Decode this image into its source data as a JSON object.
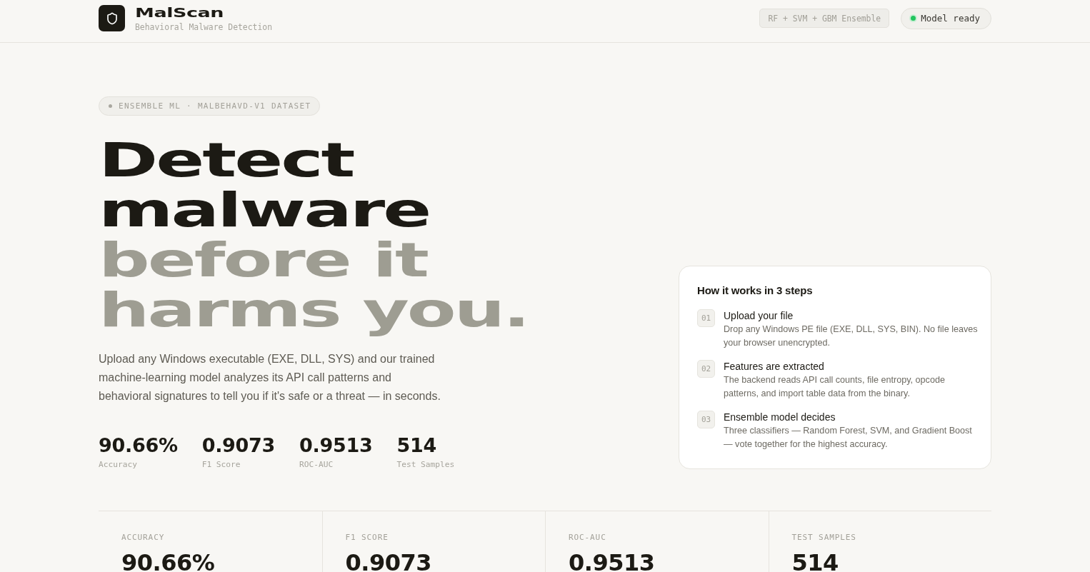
{
  "header": {
    "app_title": "MalScan",
    "app_subtitle": "Behavioral Malware Detection",
    "model_tag": "RF + SVM + GBM Ensemble",
    "status": {
      "label": "Model ready",
      "ready": true
    }
  },
  "hero": {
    "tag": "ENSEMBLE ML · MALBEHAVD-V1 DATASET",
    "headline": [
      {
        "text": "Detect",
        "muted": false
      },
      {
        "text": "malware",
        "muted": false
      },
      {
        "text": "before it",
        "muted": true
      },
      {
        "text": "harms you.",
        "muted": true
      }
    ],
    "description": "Upload any Windows executable (EXE, DLL, SYS) and our trained machine-learning model analyzes its API call patterns and behavioral signatures to tell you if it's safe or a threat — in seconds.",
    "stats": [
      {
        "value": "90.66%",
        "label": "Accuracy"
      },
      {
        "value": "0.9073",
        "label": "F1 Score"
      },
      {
        "value": "0.9513",
        "label": "ROC-AUC"
      },
      {
        "value": "514",
        "label": "Test Samples"
      }
    ]
  },
  "steps_card": {
    "title": "How it works in 3 steps",
    "steps": [
      {
        "number": "01",
        "title": "Upload your file",
        "description": "Drop any Windows PE file (EXE, DLL, SYS, BIN). No file leaves your browser unencrypted."
      },
      {
        "number": "02",
        "title": "Features are extracted",
        "description": "The backend reads API call counts, file entropy, opcode patterns, and import table data from the binary."
      },
      {
        "number": "03",
        "title": "Ensemble model decides",
        "description": "Three classifiers — Random Forest, SVM, and Gradient Boost — vote together for the highest accuracy."
      }
    ]
  },
  "metrics": [
    {
      "label": "ACCURACY",
      "value": "90.66%"
    },
    {
      "label": "F1 SCORE",
      "value": "0.9073"
    },
    {
      "label": "ROC-AUC",
      "value": "0.9513"
    },
    {
      "label": "TEST SAMPLES",
      "value": "514"
    }
  ]
}
